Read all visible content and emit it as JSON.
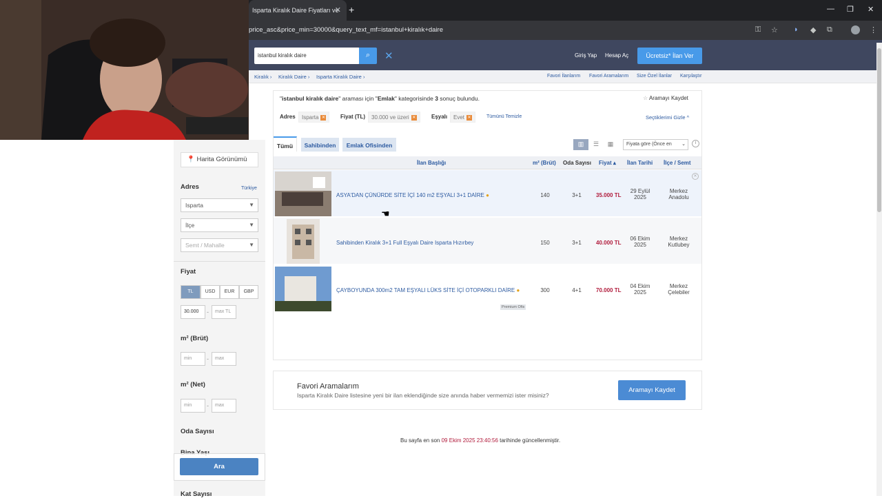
{
  "browser": {
    "tab_title": "Isparta Kiralık Daire Fiyatları ve",
    "url": "price_asc&price_min=30000&query_text_mf=istanbul+kiralık+daire"
  },
  "header": {
    "search_value": "istanbul kiralık daire",
    "login": "Giriş Yap",
    "register": "Hesap Aç",
    "post_ad": "Ücretsiz* İlan Ver"
  },
  "breadcrumb": [
    "Kiralık ›",
    "Kiralık Daire ›",
    "Isparta Kiralık Daire ›"
  ],
  "top_links": [
    "Favori İlanlarım",
    "Favori Aramalarım",
    "Size Özel İlanlar",
    "Karşılaştır"
  ],
  "filters": {
    "map_view": "Harita Görünümü",
    "address_label": "Adres",
    "country": "Türkiye",
    "city": "Isparta",
    "district": "İlçe",
    "neighborhood": "Semt / Mahalle",
    "price_label": "Fiyat",
    "currencies": [
      "TL",
      "USD",
      "EUR",
      "GBP"
    ],
    "price_min": "30.000",
    "price_max_placeholder": "max TL",
    "m2_brut_label": "m² (Brüt)",
    "m2_net_label": "m² (Net)",
    "min": "min",
    "max": "max",
    "dash": "-",
    "rooms_label": "Oda Sayısı",
    "building_age_label": "Bina Yaşı",
    "floor_count_label": "Kat Sayısı",
    "search_button": "Ara"
  },
  "results": {
    "summary_query": "istanbul kiralık daire",
    "summary_mid": "\" araması için \"",
    "summary_category": "Emlak",
    "summary_mid2": "\" kategorisinde",
    "count": "3",
    "summary_end": "sonuç bulundu.",
    "save_search": "Aramayı Kaydet",
    "chips": {
      "address_label": "Adres",
      "address_value": "Isparta",
      "price_label": "Fiyat (TL)",
      "price_value": "30.000 ve üzeri",
      "furnished_label": "Eşyalı",
      "furnished_value": "Evet",
      "clear_all": "Tümünü Temizle",
      "hide": "Seçtiklerimi Gizle ^"
    },
    "tabs": [
      "Tümü",
      "Sahibinden",
      "Emlak Ofisinden"
    ],
    "sort": "Fiyata göre (Önce en",
    "columns": [
      "İlan Başlığı",
      "m² (Brüt)",
      "Oda Sayısı",
      "Fiyat ▴",
      "İlan Tarihi",
      "İlçe / Semt"
    ],
    "rows": [
      {
        "title": "ASYA'DAN ÇÜNÜRDE SİTE İÇİ 140 m2 EŞYALI 3+1 DAİRE",
        "m2": "140",
        "rooms": "3+1",
        "price": "35.000 TL",
        "date1": "29 Eylül",
        "date2": "2025",
        "loc1": "Merkez",
        "loc2": "Anadolu"
      },
      {
        "title": "Sahibinden Kiralık 3+1 Full Eşyalı Daire Isparta Hızırbey",
        "m2": "150",
        "rooms": "3+1",
        "price": "40.000 TL",
        "date1": "06 Ekim",
        "date2": "2025",
        "loc1": "Merkez",
        "loc2": "Kutlubey"
      },
      {
        "title": "ÇAYBOYUNDA 300m2 TAM EŞYALI LÜKS SİTE İÇİ OTOPARKLI DAİRE",
        "m2": "300",
        "rooms": "4+1",
        "price": "70.000 TL",
        "date1": "04 Ekim",
        "date2": "2025",
        "loc1": "Merkez",
        "loc2": "Çelebiler",
        "badge": "Premium Ofis"
      }
    ]
  },
  "favorites": {
    "title": "Favori Aramalarım",
    "desc": "Isparta Kiralık Daire listesine yeni bir ilan eklendiğinde size anında haber vermemizi ister misiniz?",
    "button": "Aramayı Kaydet"
  },
  "footer": {
    "pre": "Bu sayfa en son",
    "timestamp": "09 Ekim 2025 23:40:56",
    "post": "tarihinde güncellenmiştir."
  },
  "colors": {
    "accent": "#489ae9",
    "header": "#3f475f",
    "price": "#b0193a",
    "link": "#2c5aa0"
  }
}
